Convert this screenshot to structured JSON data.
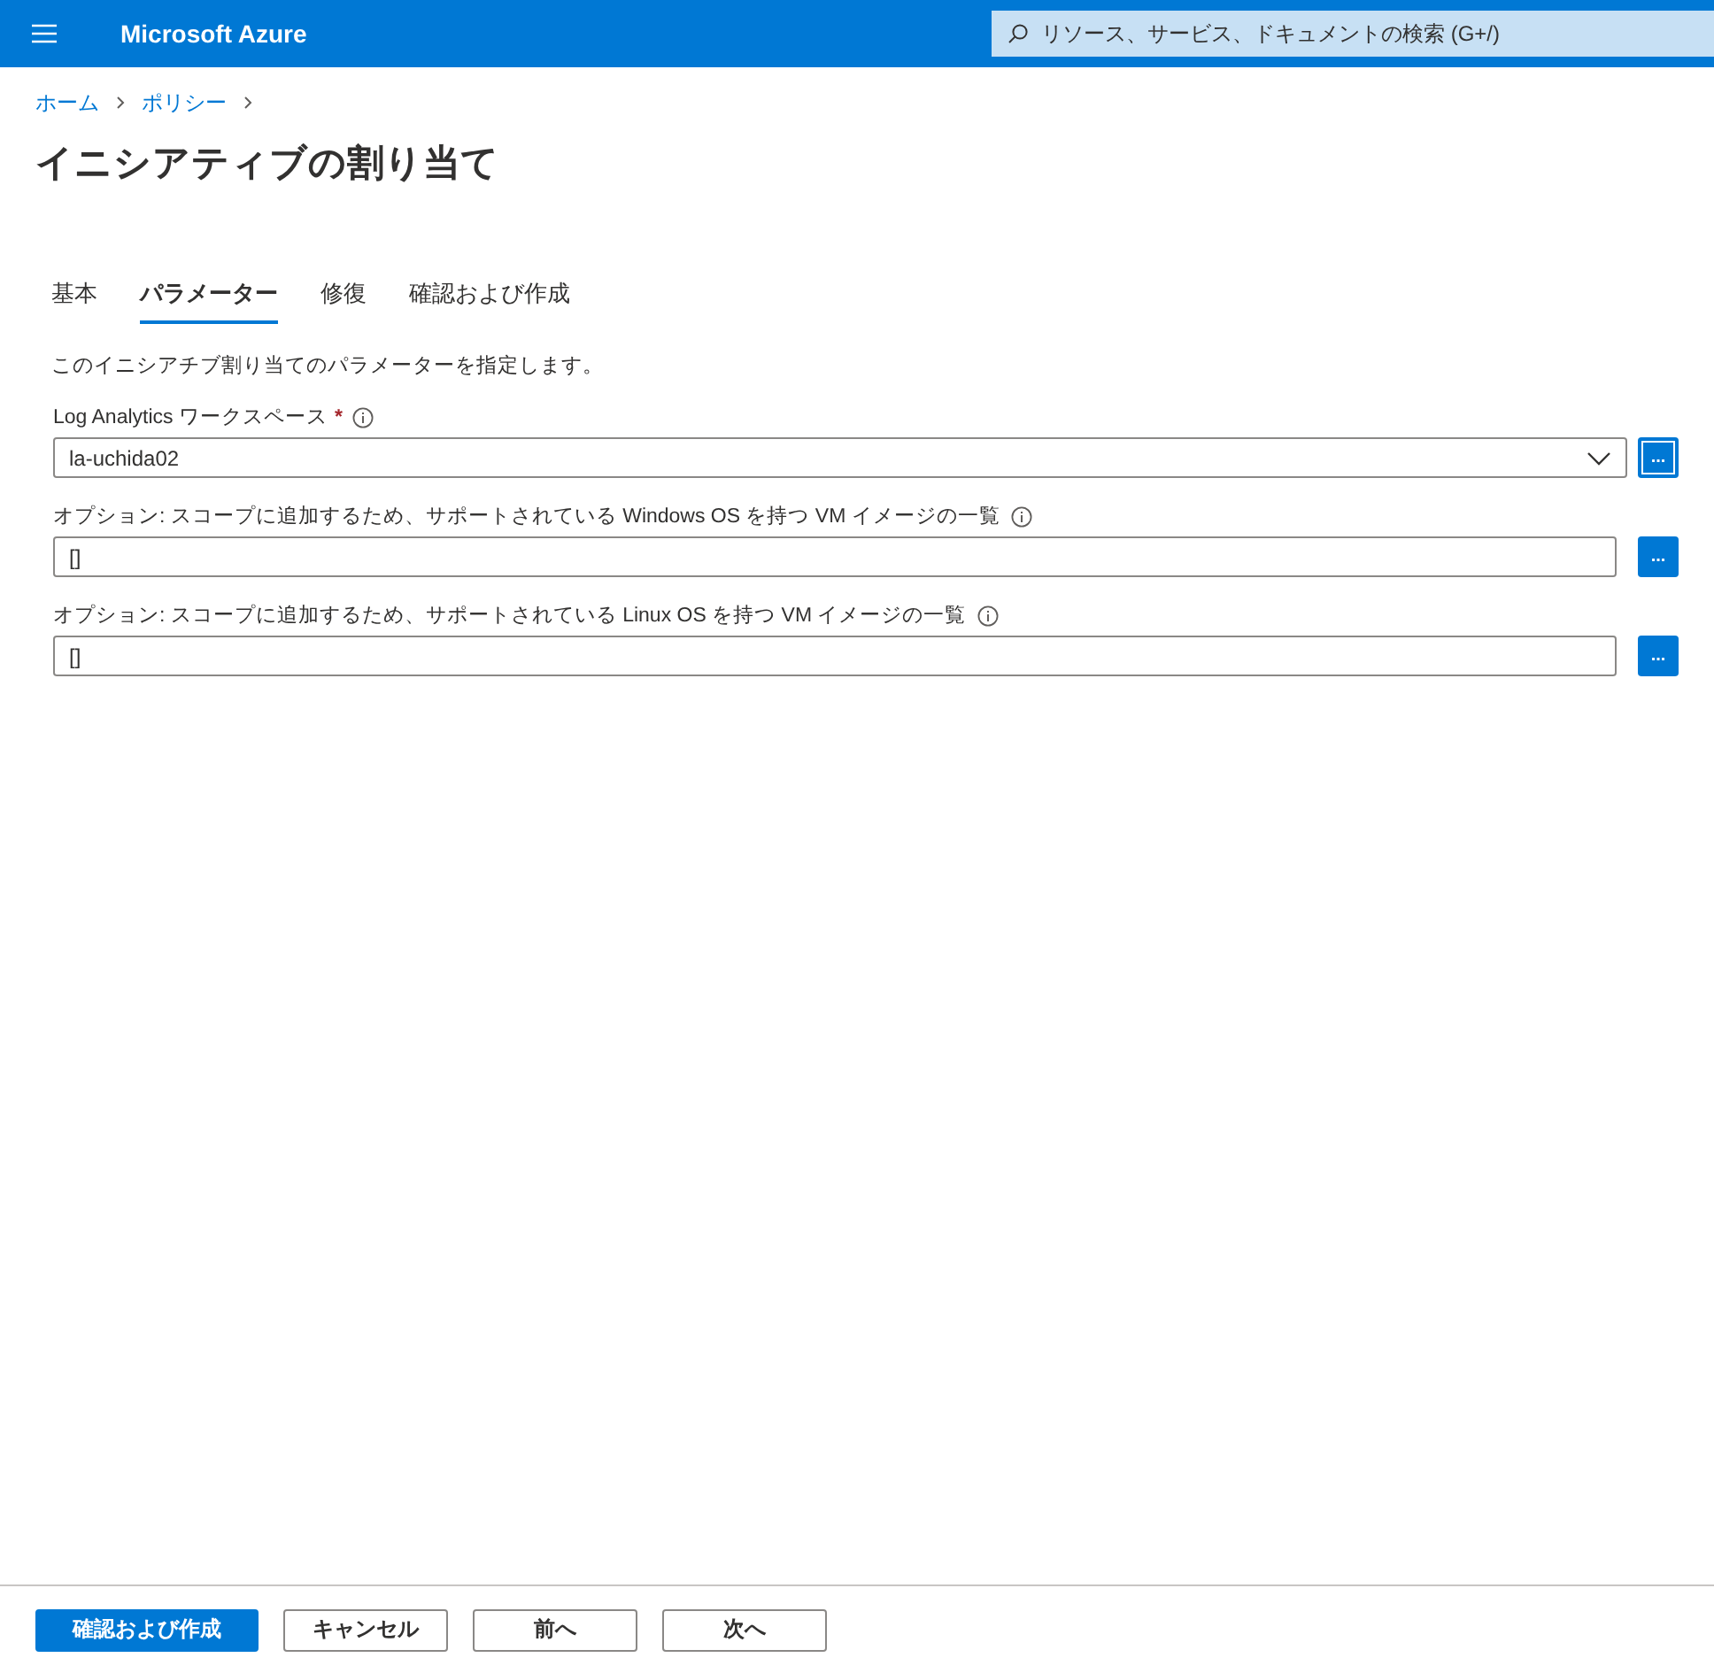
{
  "header": {
    "title": "Microsoft Azure",
    "search": {
      "placeholder": "リソース、サービス、ドキュメントの検索 (G+/)"
    }
  },
  "breadcrumb": [
    "ホーム",
    "ポリシー"
  ],
  "page_title": "イニシアティブの割り当て",
  "tabs": [
    {
      "label": "基本",
      "selected": false
    },
    {
      "label": "パラメーター",
      "selected": true
    },
    {
      "label": "修復",
      "selected": false
    },
    {
      "label": "確認および作成",
      "selected": false
    }
  ],
  "description": "このイニシアチブ割り当てのパラメーターを指定します。",
  "fields": [
    {
      "kind": "select",
      "label": "Log Analytics ワークスペース",
      "required_mark": "*",
      "value": "la-uchida02",
      "button": "...",
      "focused": true
    },
    {
      "kind": "text",
      "label": "オプション: スコープに追加するため、サポートされている Windows OS を持つ VM イメージの一覧",
      "value": "[]",
      "button": "...",
      "focused": false
    },
    {
      "kind": "text",
      "label": "オプション: スコープに追加するため、サポートされている Linux OS を持つ VM イメージの一覧",
      "value": "[]",
      "button": "...",
      "focused": false
    }
  ],
  "footer": {
    "buttons": [
      {
        "label": "確認および作成",
        "kind": "primary"
      },
      {
        "label": "キャンセル",
        "kind": "secondary"
      },
      {
        "label": "前へ",
        "kind": "secondary"
      },
      {
        "label": "次へ",
        "kind": "secondary"
      }
    ]
  }
}
